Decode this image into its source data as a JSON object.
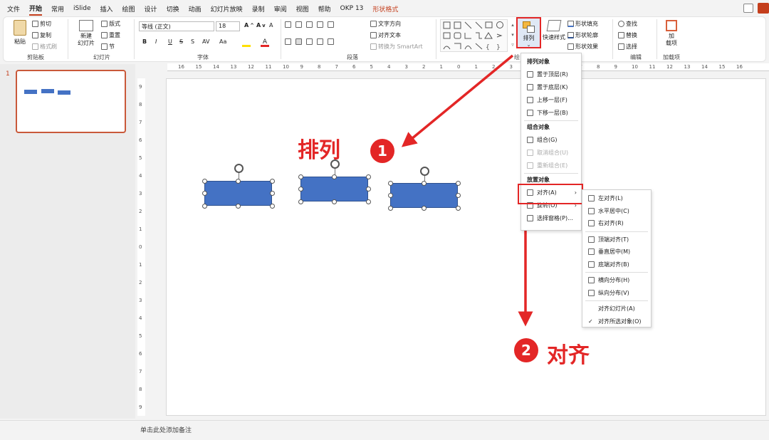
{
  "menubar": {
    "tabs": [
      "文件",
      "开始",
      "常用",
      "iSlide",
      "插入",
      "绘图",
      "设计",
      "切换",
      "动画",
      "幻灯片放映",
      "录制",
      "审阅",
      "视图",
      "帮助",
      "OKP 13",
      "形状格式"
    ],
    "active_tab": "开始",
    "contextual_tab": "形状格式"
  },
  "ribbon": {
    "clipboard": {
      "paste": "粘贴",
      "cut": "剪切",
      "copy": "复制",
      "format_painter": "格式刷",
      "label": "剪贴板"
    },
    "slides": {
      "new_slide": "新建\n幻灯片",
      "layout": "版式",
      "reset": "重置",
      "section": "节",
      "label": "幻灯片"
    },
    "font": {
      "font_name": "等线 (正文)",
      "font_size": "18",
      "bold": "B",
      "italic": "I",
      "underline": "U",
      "strike": "S",
      "shadow": "S",
      "spacing": "AV",
      "case": "Aa",
      "clear": "A",
      "label": "字体"
    },
    "paragraph": {
      "text_direction": "文字方向",
      "align_text": "对齐文本",
      "smartart": "转换为 SmartArt",
      "label": "段落"
    },
    "drawing": {
      "arrange": "排列",
      "quick_styles": "快速样式",
      "shape_fill": "形状填充",
      "shape_outline": "形状轮廓",
      "shape_effects": "形状效果",
      "label": "绘"
    },
    "editing": {
      "find": "查找",
      "replace": "替换",
      "select": "选择",
      "label": "编辑"
    },
    "addins": {
      "addins": "加\n载项",
      "label": "加载项"
    }
  },
  "thumbnail": {
    "number": "1"
  },
  "ruler_h_ticks": [
    "16",
    "15",
    "14",
    "13",
    "12",
    "11",
    "10",
    "9",
    "8",
    "7",
    "6",
    "5",
    "4",
    "3",
    "2",
    "1",
    "0",
    "1",
    "2",
    "3",
    "4",
    "5",
    "6",
    "7",
    "8",
    "9",
    "10",
    "11",
    "12",
    "13",
    "14",
    "15",
    "16"
  ],
  "ruler_v_ticks": [
    "9",
    "8",
    "7",
    "6",
    "5",
    "4",
    "3",
    "2",
    "1",
    "0",
    "1",
    "2",
    "3",
    "4",
    "5",
    "6",
    "7",
    "8",
    "9"
  ],
  "arrange_menu": {
    "order_header": "排列对象",
    "order_items": [
      "置于顶层(R)",
      "置于底层(K)",
      "上移一层(F)",
      "下移一层(B)"
    ],
    "group_header": "组合对象",
    "group_items": [
      "组合(G)",
      "取消组合(U)",
      "重新组合(E)"
    ],
    "position_header": "放置对象",
    "position_items": [
      "对齐(A)",
      "旋转(O)",
      "选择窗格(P)..."
    ]
  },
  "align_submenu": {
    "items": [
      "左对齐(L)",
      "水平居中(C)",
      "右对齐(R)",
      "顶端对齐(T)",
      "垂直居中(M)",
      "底端对齐(B)",
      "横向分布(H)",
      "纵向分布(V)",
      "对齐幻灯片(A)",
      "对齐所选对象(O)"
    ],
    "checked": "对齐所选对象(O)"
  },
  "annotations": {
    "label1": "排列",
    "num1": "1",
    "label2": "对齐",
    "num2": "2",
    "color": "#e32626"
  },
  "notes": {
    "placeholder": "单击此处添加备注"
  }
}
